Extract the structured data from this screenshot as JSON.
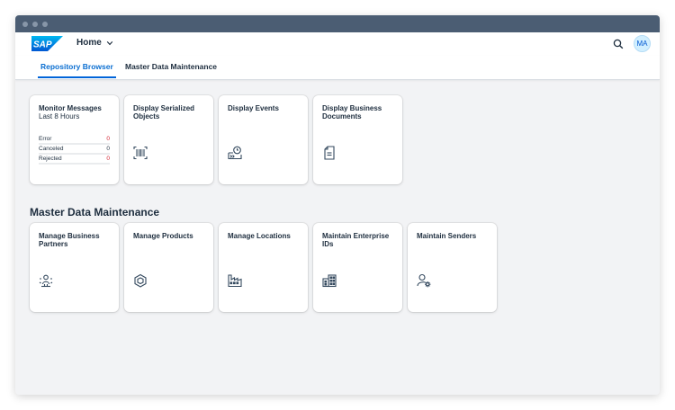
{
  "shell": {
    "home_label": "Home",
    "avatar_initials": "MA",
    "brand_color": "#0070f2"
  },
  "tabs": [
    {
      "label": "Repository Browser",
      "active": true
    },
    {
      "label": "Master Data Maintenance",
      "active": false
    }
  ],
  "repository_tiles": [
    {
      "title": "Monitor Messages",
      "subtitle": "Last 8 Hours",
      "rows": [
        {
          "label": "Error",
          "value": "0"
        },
        {
          "label": "Canceled",
          "value": "0"
        },
        {
          "label": "Rejected",
          "value": "0"
        }
      ]
    },
    {
      "title": "Display Serialized Objects",
      "icon": "barcode-icon"
    },
    {
      "title": "Display Events",
      "icon": "event-history-icon"
    },
    {
      "title": "Display Business Documents",
      "icon": "document-icon"
    }
  ],
  "master_data": {
    "section_title": "Master Data Maintenance",
    "tiles": [
      {
        "title": "Manage Business Partners",
        "icon": "business-partners-icon"
      },
      {
        "title": "Manage Products",
        "icon": "product-box-icon"
      },
      {
        "title": "Manage Locations",
        "icon": "factory-location-icon"
      },
      {
        "title": "Maintain Enterprise IDs",
        "icon": "building-icon"
      },
      {
        "title": "Maintain Senders",
        "icon": "user-settings-icon"
      }
    ]
  }
}
